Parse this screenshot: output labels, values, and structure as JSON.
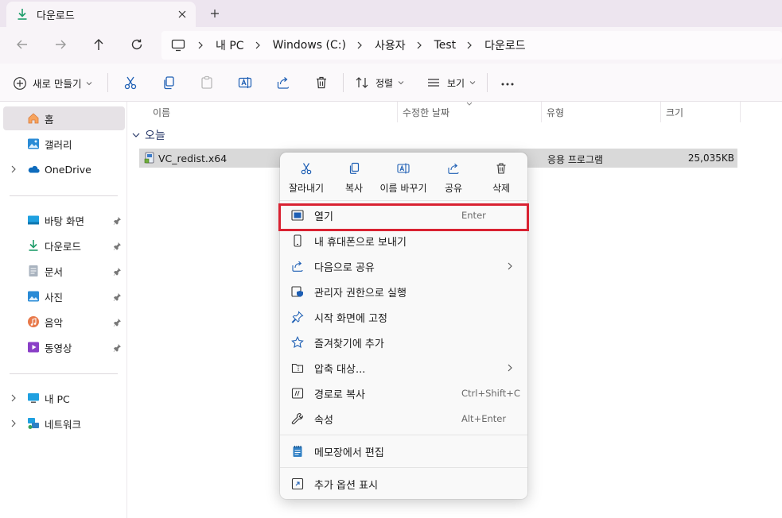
{
  "window": {
    "tab_title": "다운로드",
    "tab_icon": "download-icon"
  },
  "address": {
    "breadcrumbs": [
      "내 PC",
      "Windows (C:)",
      "사용자",
      "Test",
      "다운로드"
    ]
  },
  "toolbar": {
    "new_label": "새로 만들기",
    "sort_label": "정렬",
    "view_label": "보기"
  },
  "sidebar": {
    "home": "홈",
    "gallery": "갤러리",
    "onedrive": "OneDrive",
    "pinned": [
      "바탕 화면",
      "다운로드",
      "문서",
      "사진",
      "음악",
      "동영상"
    ],
    "this_pc": "내 PC",
    "network": "네트워크"
  },
  "columns": {
    "name": "이름",
    "modified": "수정한 날짜",
    "type": "유형",
    "size": "크기"
  },
  "group_label": "오늘",
  "file": {
    "name": "VC_redist.x64",
    "type": "응용 프로그램",
    "size": "25,035KB"
  },
  "context_menu": {
    "quick_actions": [
      "잘라내기",
      "복사",
      "이름 바꾸기",
      "공유",
      "삭제"
    ],
    "items": [
      {
        "label": "열기",
        "shortcut": "Enter",
        "icon": "open-window-icon"
      },
      {
        "label": "내 휴대폰으로 보내기",
        "shortcut": "",
        "icon": "phone-icon"
      },
      {
        "label": "다음으로 공유",
        "shortcut": "",
        "icon": "share-icon"
      },
      {
        "label": "관리자 권한으로 실행",
        "shortcut": "",
        "icon": "admin-shield-icon"
      },
      {
        "label": "시작 화면에 고정",
        "shortcut": "",
        "icon": "pin-icon"
      },
      {
        "label": "즐겨찾기에 추가",
        "shortcut": "",
        "icon": "star-icon"
      },
      {
        "label": "압축 대상...",
        "shortcut": "",
        "icon": "zip-folder-icon"
      },
      {
        "label": "경로로 복사",
        "shortcut": "Ctrl+Shift+C",
        "icon": "copy-path-icon"
      },
      {
        "label": "속성",
        "shortcut": "Alt+Enter",
        "icon": "wrench-icon"
      },
      {
        "label": "메모장에서 편집",
        "shortcut": "",
        "icon": "notepad-icon"
      },
      {
        "label": "추가 옵션 표시",
        "shortcut": "",
        "icon": "more-options-icon"
      }
    ]
  },
  "colors": {
    "accent": "#0067c0",
    "highlight_border": "#d92232",
    "selected_row": "#d9d9d9"
  }
}
